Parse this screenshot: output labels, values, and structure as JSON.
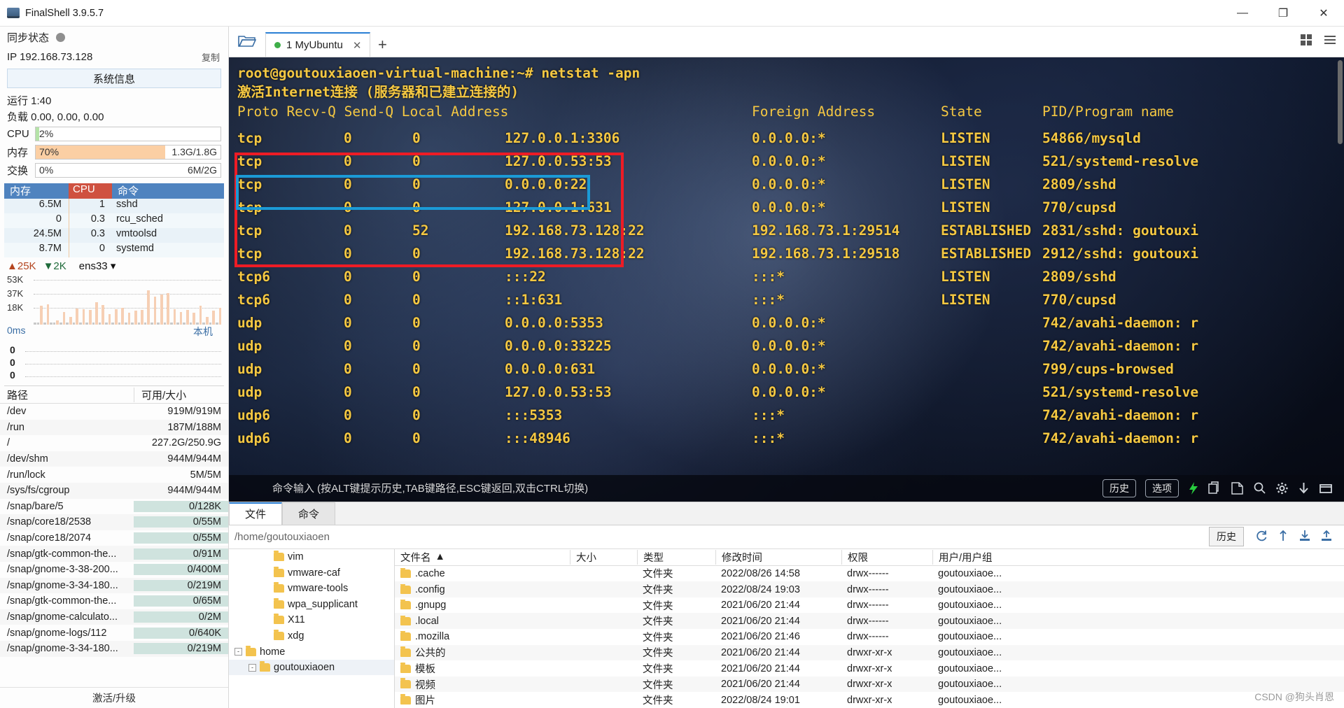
{
  "window": {
    "title": "FinalShell 3.9.5.7",
    "minimize": "—",
    "maximize": "❐",
    "close": "✕"
  },
  "sidebar": {
    "sync_label": "同步状态",
    "ip_label": "IP 192.168.73.128",
    "copy_label": "复制",
    "sysinfo_button": "系统信息",
    "uptime": "运行 1:40",
    "load": "负载 0.00, 0.00, 0.00",
    "meters": [
      {
        "name": "CPU",
        "pct": "2%",
        "fill": 2,
        "right": "",
        "color": "#b5e3a8"
      },
      {
        "name": "内存",
        "pct": "70%",
        "fill": 70,
        "right": "1.3G/1.8G",
        "color": "#fbcfa4"
      },
      {
        "name": "交换",
        "pct": "0%",
        "fill": 0,
        "right": "6M/2G",
        "color": "#fbcfa4"
      }
    ],
    "proc_headers": [
      "内存",
      "CPU",
      "命令"
    ],
    "processes": [
      {
        "mem": "6.5M",
        "cpu": "1",
        "cmd": "sshd"
      },
      {
        "mem": "0",
        "cpu": "0.3",
        "cmd": "rcu_sched"
      },
      {
        "mem": "24.5M",
        "cpu": "0.3",
        "cmd": "vmtoolsd"
      },
      {
        "mem": "8.7M",
        "cpu": "0",
        "cmd": "systemd"
      }
    ],
    "net": {
      "up": "25K",
      "down": "2K",
      "iface": "ens33",
      "y_labels": [
        "53K",
        "37K",
        "18K"
      ],
      "bars": [
        0,
        0,
        38,
        0,
        42,
        0,
        0,
        8,
        0,
        26,
        0,
        16,
        0,
        33,
        0,
        31,
        0,
        30,
        0,
        46,
        0,
        40,
        0,
        22,
        0,
        31,
        0,
        34,
        0,
        25,
        0,
        29,
        0,
        30,
        0,
        70,
        0,
        57,
        0,
        62,
        0,
        64,
        0,
        31,
        0,
        26,
        0,
        30,
        0,
        25,
        0,
        38,
        0,
        16,
        0,
        29,
        0,
        34
      ]
    },
    "latency": {
      "title": "0ms",
      "host_label": "本机",
      "y_labels": [
        "0",
        "0",
        "0"
      ]
    },
    "disk_headers": [
      "路径",
      "可用/大小"
    ],
    "disks": [
      {
        "path": "/dev",
        "size": "919M/919M",
        "full": false
      },
      {
        "path": "/run",
        "size": "187M/188M",
        "full": false
      },
      {
        "path": "/",
        "size": "227.2G/250.9G",
        "full": false
      },
      {
        "path": "/dev/shm",
        "size": "944M/944M",
        "full": false
      },
      {
        "path": "/run/lock",
        "size": "5M/5M",
        "full": false
      },
      {
        "path": "/sys/fs/cgroup",
        "size": "944M/944M",
        "full": false
      },
      {
        "path": "/snap/bare/5",
        "size": "0/128K",
        "full": true
      },
      {
        "path": "/snap/core18/2538",
        "size": "0/55M",
        "full": true
      },
      {
        "path": "/snap/core18/2074",
        "size": "0/55M",
        "full": true
      },
      {
        "path": "/snap/gtk-common-the...",
        "size": "0/91M",
        "full": true
      },
      {
        "path": "/snap/gnome-3-38-200...",
        "size": "0/400M",
        "full": true
      },
      {
        "path": "/snap/gnome-3-34-180...",
        "size": "0/219M",
        "full": true
      },
      {
        "path": "/snap/gtk-common-the...",
        "size": "0/65M",
        "full": true
      },
      {
        "path": "/snap/gnome-calculato...",
        "size": "0/2M",
        "full": true
      },
      {
        "path": "/snap/gnome-logs/112",
        "size": "0/640K",
        "full": true
      },
      {
        "path": "/snap/gnome-3-34-180...",
        "size": "0/219M",
        "full": true
      }
    ],
    "activate_label": "激活/升级"
  },
  "tabs": {
    "open_folder_icon": "folder-open-icon",
    "items": [
      {
        "label": "1 MyUbuntu",
        "active": true
      }
    ],
    "add_label": "+",
    "grid_icon": "grid-icon",
    "menu_icon": "hamburger-icon"
  },
  "terminal": {
    "prompt_line": "root@goutouxiaoen-virtual-machine:~# netstat -apn",
    "subtitle": "激活Internet连接 (服务器和已建立连接的)",
    "columns": [
      "Proto Recv-Q Send-Q Local Address",
      "Foreign Address",
      "State",
      "PID/Program name"
    ],
    "rows": [
      {
        "proto": "tcp",
        "recv": "0",
        "send": "0",
        "local": "127.0.0.1:3306",
        "foreign": "0.0.0.0:*",
        "state": "LISTEN",
        "pid": "54866/mysqld"
      },
      {
        "proto": "tcp",
        "recv": "0",
        "send": "0",
        "local": "127.0.0.53:53",
        "foreign": "0.0.0.0:*",
        "state": "LISTEN",
        "pid": "521/systemd-resolve"
      },
      {
        "proto": "tcp",
        "recv": "0",
        "send": "0",
        "local": "0.0.0.0:22",
        "foreign": "0.0.0.0:*",
        "state": "LISTEN",
        "pid": "2809/sshd"
      },
      {
        "proto": "tcp",
        "recv": "0",
        "send": "0",
        "local": "127.0.0.1:631",
        "foreign": "0.0.0.0:*",
        "state": "LISTEN",
        "pid": "770/cupsd"
      },
      {
        "proto": "tcp",
        "recv": "0",
        "send": "52",
        "local": "192.168.73.128:22",
        "foreign": "192.168.73.1:29514",
        "state": "ESTABLISHED",
        "pid": "2831/sshd: goutouxi"
      },
      {
        "proto": "tcp",
        "recv": "0",
        "send": "0",
        "local": "192.168.73.128:22",
        "foreign": "192.168.73.1:29518",
        "state": "ESTABLISHED",
        "pid": "2912/sshd: goutouxi"
      },
      {
        "proto": "tcp6",
        "recv": "0",
        "send": "0",
        "local": ":::22",
        "foreign": ":::*",
        "state": "LISTEN",
        "pid": "2809/sshd"
      },
      {
        "proto": "tcp6",
        "recv": "0",
        "send": "0",
        "local": "::1:631",
        "foreign": ":::*",
        "state": "LISTEN",
        "pid": "770/cupsd"
      },
      {
        "proto": "udp",
        "recv": "0",
        "send": "0",
        "local": "0.0.0.0:5353",
        "foreign": "0.0.0.0:*",
        "state": "",
        "pid": "742/avahi-daemon: r"
      },
      {
        "proto": "udp",
        "recv": "0",
        "send": "0",
        "local": "0.0.0.0:33225",
        "foreign": "0.0.0.0:*",
        "state": "",
        "pid": "742/avahi-daemon: r"
      },
      {
        "proto": "udp",
        "recv": "0",
        "send": "0",
        "local": "0.0.0.0:631",
        "foreign": "0.0.0.0:*",
        "state": "",
        "pid": "799/cups-browsed"
      },
      {
        "proto": "udp",
        "recv": "0",
        "send": "0",
        "local": "127.0.0.53:53",
        "foreign": "0.0.0.0:*",
        "state": "",
        "pid": "521/systemd-resolve"
      },
      {
        "proto": "udp6",
        "recv": "0",
        "send": "0",
        "local": ":::5353",
        "foreign": ":::*",
        "state": "",
        "pid": "742/avahi-daemon: r"
      },
      {
        "proto": "udp6",
        "recv": "0",
        "send": "0",
        "local": ":::48946",
        "foreign": ":::*",
        "state": "",
        "pid": "742/avahi-daemon: r"
      }
    ],
    "highlight_red": "#ee1c25",
    "highlight_blue": "#1b9ad6",
    "command_placeholder": "命令输入 (按ALT键提示历史,TAB键路径,ESC键返回,双击CTRL切换)",
    "history_button": "历史",
    "options_button": "选项"
  },
  "filepanel": {
    "tabs": [
      {
        "label": "文件",
        "active": true
      },
      {
        "label": "命令",
        "active": false
      }
    ],
    "path": "/home/goutouxiaoen",
    "history_button": "历史",
    "tree": [
      {
        "label": "vim",
        "depth": 2,
        "expander": null,
        "selected": false
      },
      {
        "label": "vmware-caf",
        "depth": 2,
        "expander": null,
        "selected": false
      },
      {
        "label": "vmware-tools",
        "depth": 2,
        "expander": null,
        "selected": false
      },
      {
        "label": "wpa_supplicant",
        "depth": 2,
        "expander": null,
        "selected": false
      },
      {
        "label": "X11",
        "depth": 2,
        "expander": null,
        "selected": false
      },
      {
        "label": "xdg",
        "depth": 2,
        "expander": null,
        "selected": false
      },
      {
        "label": "home",
        "depth": 0,
        "expander": "-",
        "selected": false
      },
      {
        "label": "goutouxiaoen",
        "depth": 1,
        "expander": "-",
        "selected": true
      }
    ],
    "columns": [
      "文件名",
      "大小",
      "类型",
      "修改时间",
      "权限",
      "用户/用户组"
    ],
    "sort_indicator": "▲",
    "files": [
      {
        "name": ".cache",
        "size": "",
        "type": "文件夹",
        "time": "2022/08/26 14:58",
        "perm": "drwx------",
        "user": "goutouxiaoe..."
      },
      {
        "name": ".config",
        "size": "",
        "type": "文件夹",
        "time": "2022/08/24 19:03",
        "perm": "drwx------",
        "user": "goutouxiaoe..."
      },
      {
        "name": ".gnupg",
        "size": "",
        "type": "文件夹",
        "time": "2021/06/20 21:44",
        "perm": "drwx------",
        "user": "goutouxiaoe..."
      },
      {
        "name": ".local",
        "size": "",
        "type": "文件夹",
        "time": "2021/06/20 21:44",
        "perm": "drwx------",
        "user": "goutouxiaoe..."
      },
      {
        "name": ".mozilla",
        "size": "",
        "type": "文件夹",
        "time": "2021/06/20 21:46",
        "perm": "drwx------",
        "user": "goutouxiaoe..."
      },
      {
        "name": "公共的",
        "size": "",
        "type": "文件夹",
        "time": "2021/06/20 21:44",
        "perm": "drwxr-xr-x",
        "user": "goutouxiaoe..."
      },
      {
        "name": "模板",
        "size": "",
        "type": "文件夹",
        "time": "2021/06/20 21:44",
        "perm": "drwxr-xr-x",
        "user": "goutouxiaoe..."
      },
      {
        "name": "视频",
        "size": "",
        "type": "文件夹",
        "time": "2021/06/20 21:44",
        "perm": "drwxr-xr-x",
        "user": "goutouxiaoe..."
      },
      {
        "name": "图片",
        "size": "",
        "type": "文件夹",
        "time": "2022/08/24 19:01",
        "perm": "drwxr-xr-x",
        "user": "goutouxiaoe..."
      }
    ]
  },
  "watermark": "CSDN @狗头肖恩"
}
